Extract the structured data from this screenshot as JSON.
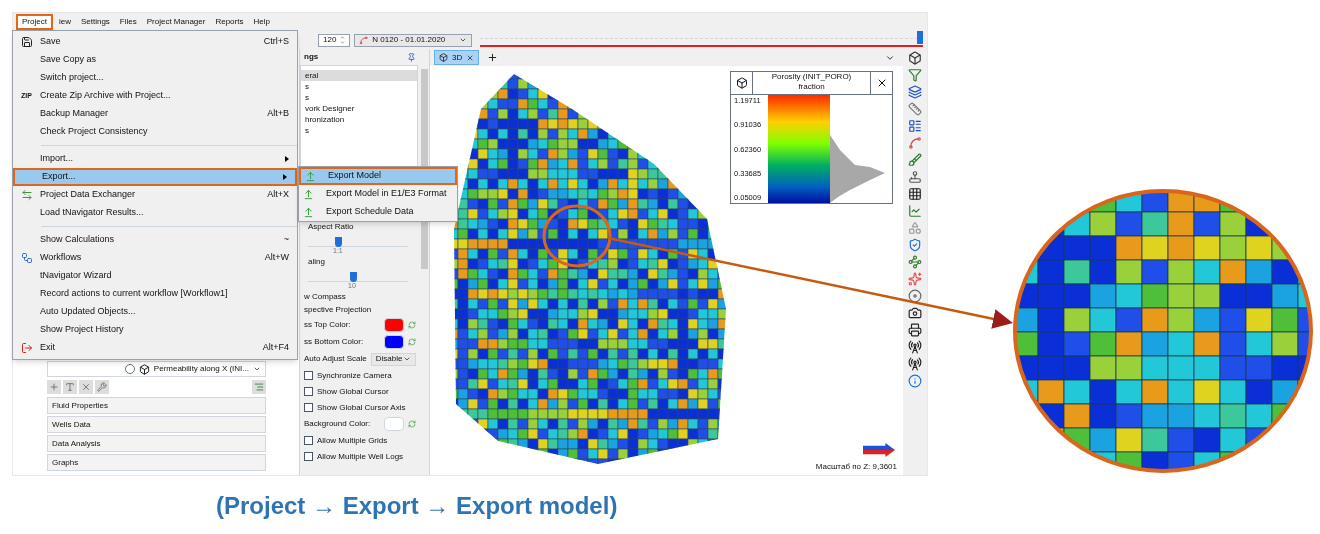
{
  "menubar": [
    {
      "label": "Project",
      "selected": true
    },
    {
      "label": "iew",
      "selected": false
    },
    {
      "label": "Settings",
      "selected": false
    },
    {
      "label": "Files",
      "selected": false
    },
    {
      "label": "Project Manager",
      "selected": false
    },
    {
      "label": "Reports",
      "selected": false
    },
    {
      "label": "Help",
      "selected": false
    }
  ],
  "toolbar": {
    "step_value": "120",
    "date": "N 0120 - 01.01.2020",
    "timeline": {
      "level": 1
    }
  },
  "project_menu": [
    {
      "label": "Save",
      "shortcut": "Ctrl+S",
      "highlighted": false
    },
    {
      "label": "Save Copy as",
      "highlighted": false
    },
    {
      "label": "Switch project...",
      "highlighted": false
    },
    {
      "label": "Create Zip Archive with Project...",
      "icon_text": "ZIP",
      "highlighted": false
    },
    {
      "label": "Backup Manager",
      "shortcut": "Alt+B",
      "highlighted": false
    },
    {
      "label": "Check Project Consistency",
      "highlighted": false
    },
    {
      "label": "Import...",
      "submenu": true,
      "separator_before": true,
      "highlighted": false
    },
    {
      "label": "Export...",
      "submenu": true,
      "highlighted": true
    },
    {
      "label": "Project Data Exchanger",
      "shortcut": "Alt+X",
      "highlighted": false
    },
    {
      "label": "Load tNavigator Results...",
      "highlighted": false
    },
    {
      "label": "Show Calculations",
      "shortcut": "~",
      "separator_before": true,
      "highlighted": false
    },
    {
      "label": "Workflows",
      "shortcut": "Alt+W",
      "highlighted": false
    },
    {
      "label": "tNavigator Wizard",
      "highlighted": false
    },
    {
      "label": "Record actions to current workflow [Workflow1]",
      "highlighted": false
    },
    {
      "label": "Auto Updated Objects...",
      "highlighted": false
    },
    {
      "label": "Show Project History",
      "highlighted": false
    },
    {
      "label": "Exit",
      "shortcut": "Alt+F4",
      "highlighted": false
    }
  ],
  "export_submenu": [
    {
      "label": "Export Model",
      "highlighted": true
    },
    {
      "label": "Export Model in E1/E3 Format",
      "highlighted": false
    },
    {
      "label": "Export Schedule Data",
      "highlighted": false
    }
  ],
  "left_panel": {
    "property_select": {
      "label": "Permeability along X (INI...",
      "selected": false
    },
    "sections": [
      "Fluid Properties",
      "Wells Data",
      "Data Analysis",
      "Graphs"
    ]
  },
  "settings": {
    "title": "ngs",
    "tree": [
      {
        "label": "eral",
        "selected": true
      },
      {
        "label": "s",
        "selected": false
      },
      {
        "label": "s",
        "selected": false
      },
      {
        "label": "vork Designer",
        "selected": false
      },
      {
        "label": "hronization",
        "selected": false
      },
      {
        "label": "s",
        "selected": false
      }
    ],
    "aspect_ratio": {
      "label": "Aspect Ratio",
      "level": 0.3,
      "tick": "1:1"
    },
    "scaling": {
      "label": "aling",
      "level": 0.45,
      "tick": "10"
    },
    "options": [
      {
        "kind": "text",
        "label": "w Compass"
      },
      {
        "kind": "text",
        "label": "spective Projection"
      },
      {
        "kind": "color",
        "label": "ss Top Color:",
        "color": "#ff0000"
      },
      {
        "kind": "color",
        "label": "ss Bottom Color:",
        "color": "#0000ff"
      },
      {
        "kind": "select",
        "label": "Auto Adjust Scale",
        "value": "Disable"
      },
      {
        "kind": "check",
        "label": "Synchronize Camera",
        "checked": false
      },
      {
        "kind": "check",
        "label": "Show Global Cursor",
        "checked": false
      },
      {
        "kind": "check",
        "label": "Show Global Cursor Axis",
        "checked": false
      },
      {
        "kind": "color",
        "label": "Background Color:",
        "color": "#ffffff"
      },
      {
        "kind": "check",
        "label": "Allow Multiple Grids",
        "checked": false
      },
      {
        "kind": "check",
        "label": "Allow Multiple Well Logs",
        "checked": false
      }
    ]
  },
  "view": {
    "tabs": [
      {
        "label": "3D",
        "selected": true
      }
    ],
    "legend": {
      "title": "Porosity (INIT_PORO)",
      "unit": "fraction",
      "ticks": [
        "1.19711",
        "0.91036",
        "0.62360",
        "0.33685",
        "0.05009"
      ]
    },
    "status": "Масштаб по Z: 9,3601"
  },
  "caption": "(Project → Export → Export model)"
}
